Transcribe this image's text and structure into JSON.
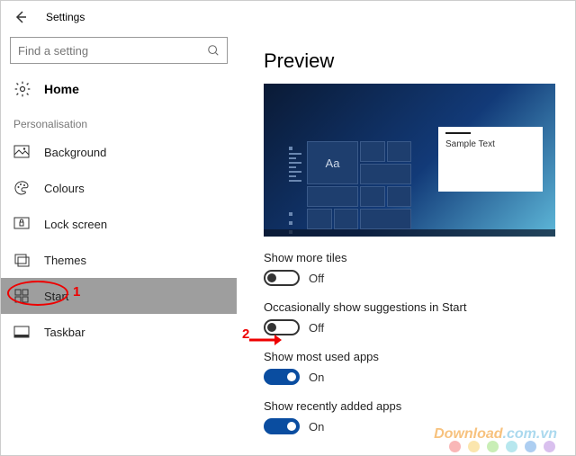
{
  "header": {
    "title": "Settings"
  },
  "search": {
    "placeholder": "Find a setting"
  },
  "home": {
    "label": "Home"
  },
  "section": {
    "label": "Personalisation"
  },
  "nav": {
    "items": [
      {
        "label": "Background"
      },
      {
        "label": "Colours"
      },
      {
        "label": "Lock screen"
      },
      {
        "label": "Themes"
      },
      {
        "label": "Start"
      },
      {
        "label": "Taskbar"
      }
    ]
  },
  "preview": {
    "title": "Preview",
    "tile_text": "Aa",
    "sample_text": "Sample Text"
  },
  "settings": {
    "more_tiles": {
      "label": "Show more tiles",
      "state": "Off",
      "on": false
    },
    "suggestions": {
      "label": "Occasionally show suggestions in Start",
      "state": "Off",
      "on": false
    },
    "most_used": {
      "label": "Show most used apps",
      "state": "On",
      "on": true
    },
    "recent": {
      "label": "Show recently added apps",
      "state": "On",
      "on": true
    }
  },
  "annotations": {
    "num1": "1",
    "num2": "2"
  },
  "watermark": {
    "a": "Download",
    "b": ".com.vn"
  },
  "dot_colors": [
    "#f47c7c",
    "#f7d26b",
    "#9de07a",
    "#7cd3e0",
    "#6aa6e6",
    "#b98de0"
  ]
}
